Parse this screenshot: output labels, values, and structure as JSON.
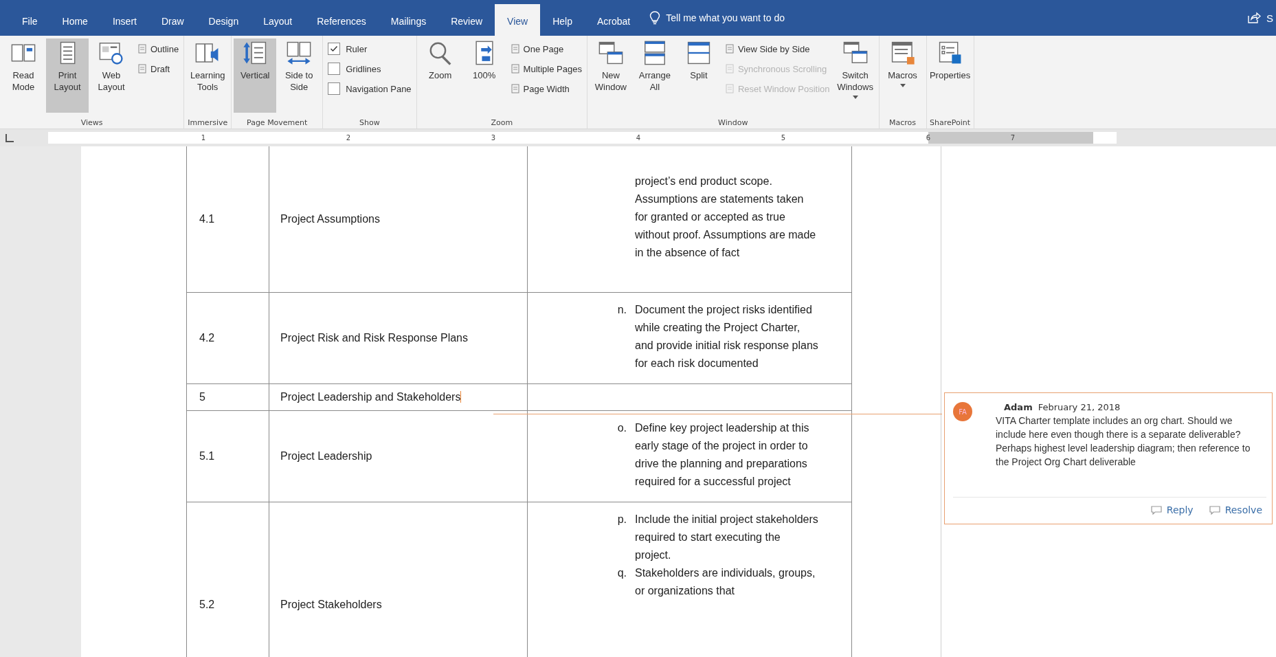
{
  "tabs": [
    {
      "label": "File",
      "selected": false
    },
    {
      "label": "Home",
      "selected": false
    },
    {
      "label": "Insert",
      "selected": false
    },
    {
      "label": "Draw",
      "selected": false
    },
    {
      "label": "Design",
      "selected": false
    },
    {
      "label": "Layout",
      "selected": false
    },
    {
      "label": "References",
      "selected": false
    },
    {
      "label": "Mailings",
      "selected": false
    },
    {
      "label": "Review",
      "selected": false
    },
    {
      "label": "View",
      "selected": true
    },
    {
      "label": "Help",
      "selected": false
    },
    {
      "label": "Acrobat",
      "selected": false
    }
  ],
  "tell_me": {
    "placeholder": "Tell me what you want to do"
  },
  "share": {
    "label": "S"
  },
  "ribbon": [
    {
      "name": "Views",
      "items": [
        {
          "kind": "large",
          "label": "Read Mode",
          "selected": false
        },
        {
          "kind": "large",
          "label": "Print Layout",
          "selected": true
        },
        {
          "kind": "large",
          "label": "Web Layout",
          "selected": false
        },
        {
          "kind": "small",
          "label": "Outline",
          "disabled": false
        },
        {
          "kind": "small",
          "label": "Draft",
          "disabled": false
        }
      ]
    },
    {
      "name": "Immersive",
      "items": [
        {
          "kind": "large",
          "label": "Learning Tools",
          "selected": false
        }
      ]
    },
    {
      "name": "Page Movement",
      "items": [
        {
          "kind": "large",
          "label": "Vertical",
          "selected": true
        },
        {
          "kind": "large",
          "label": "Side to Side",
          "selected": false
        }
      ]
    },
    {
      "name": "Show",
      "items": [
        {
          "kind": "check",
          "label": "Ruler",
          "checked": true
        },
        {
          "kind": "check",
          "label": "Gridlines",
          "checked": false
        },
        {
          "kind": "check",
          "label": "Navigation Pane",
          "checked": false
        }
      ]
    },
    {
      "name": "Zoom",
      "items": [
        {
          "kind": "large",
          "label": "Zoom",
          "selected": false
        },
        {
          "kind": "large",
          "label": "100%",
          "selected": false
        },
        {
          "kind": "small",
          "label": "One Page",
          "disabled": false
        },
        {
          "kind": "small",
          "label": "Multiple Pages",
          "disabled": false
        },
        {
          "kind": "small",
          "label": "Page Width",
          "disabled": false
        }
      ]
    },
    {
      "name": "Window",
      "items": [
        {
          "kind": "large",
          "label": "New Window",
          "selected": false
        },
        {
          "kind": "large",
          "label": "Arrange All",
          "selected": false
        },
        {
          "kind": "large",
          "label": "Split",
          "selected": false
        },
        {
          "kind": "small",
          "label": "View Side by Side",
          "disabled": false
        },
        {
          "kind": "small",
          "label": "Synchronous Scrolling",
          "disabled": true
        },
        {
          "kind": "small",
          "label": "Reset Window Position",
          "disabled": true
        },
        {
          "kind": "large",
          "label": "Switch Windows",
          "selected": false,
          "dropdown": true
        }
      ]
    },
    {
      "name": "Macros",
      "items": [
        {
          "kind": "large",
          "label": "Macros",
          "selected": false,
          "dropdown": true
        }
      ]
    },
    {
      "name": "SharePoint",
      "items": [
        {
          "kind": "large",
          "label": "Properties",
          "selected": false
        }
      ]
    }
  ],
  "ruler": [
    "1",
    "2",
    "3",
    "4",
    "5",
    "6",
    "7"
  ],
  "table": {
    "rows": [
      {
        "number": "4.1",
        "title": "Project Assumptions",
        "commented": false,
        "paragraphs": [
          {
            "text": "project’s end product scope. Assumptions are statements taken for granted or accepted as true without proof. Assumptions are made in the absence of fact"
          }
        ]
      },
      {
        "number": "4.2",
        "title": "Project Risk and Risk Response Plans",
        "commented": false,
        "paragraphs": [
          {
            "marker": "n.",
            "text": "Document the project risks identified while creating the Project Charter, and provide initial risk response plans for each risk documented"
          }
        ]
      },
      {
        "number": "5",
        "title": "Project Leadership and Stakeholders",
        "commented": true,
        "paragraphs": []
      },
      {
        "number": "5.1",
        "title": "Project Leadership",
        "commented": false,
        "paragraphs": [
          {
            "marker": "o.",
            "text": "Define key project leadership at this early stage of the project in order to drive the planning and preparations required for a successful project"
          }
        ]
      },
      {
        "number": "5.2",
        "title": "Project Stakeholders",
        "commented": false,
        "paragraphs": [
          {
            "marker": "p.",
            "text": "Include the initial project stakeholders required to start executing the project."
          },
          {
            "marker": "q.",
            "text": "Stakeholders are individuals, groups, or organizations that"
          }
        ]
      }
    ]
  },
  "comment": {
    "initials": "FA",
    "author": "Adam",
    "date": "February 21, 2018",
    "lines": [
      "VITA Charter template includes an org chart. Should we include here even though there is a separate deliverable?",
      "Perhaps highest level leadership diagram; then reference to the Project Org Chart deliverable"
    ],
    "actions": [
      "Reply",
      "Resolve"
    ]
  }
}
